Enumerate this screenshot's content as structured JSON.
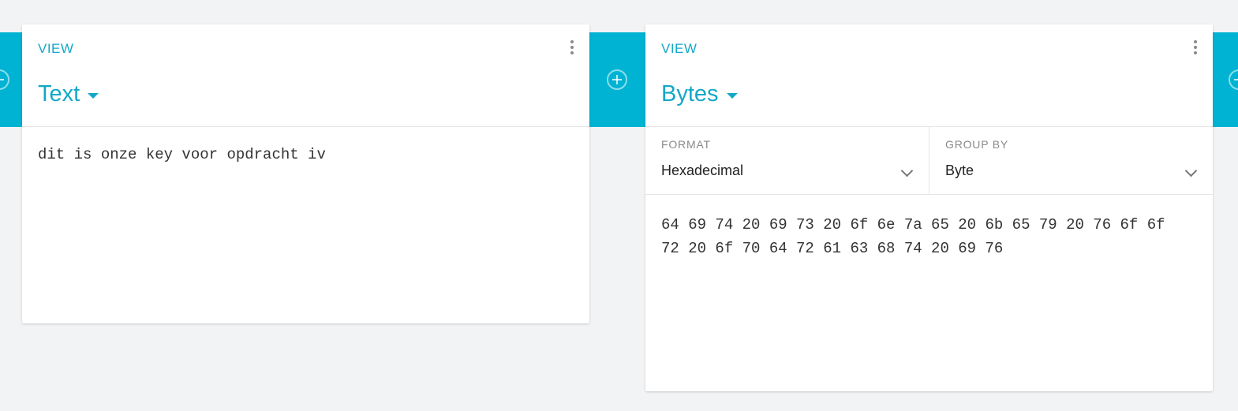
{
  "colors": {
    "accent": "#13a8c8",
    "band": "#00b3d3",
    "background": "#f2f3f5"
  },
  "left_panel": {
    "view_label": "VIEW",
    "view_type": "Text",
    "content": "dit is onze key voor opdracht iv"
  },
  "right_panel": {
    "view_label": "VIEW",
    "view_type": "Bytes",
    "format": {
      "label": "FORMAT",
      "value": "Hexadecimal"
    },
    "group_by": {
      "label": "GROUP BY",
      "value": "Byte"
    },
    "content_line1": "64 69 74 20 69 73 20 6f 6e 7a 65 20 6b 65 79 20 76 6f 6f",
    "content_line2": "72 20 6f 70 64 72 61 63 68 74 20 69 76"
  },
  "icons": {
    "add": "add-circle-icon",
    "menu": "more-vertical-icon",
    "dropdown": "caret-down-icon",
    "select": "chevron-down-icon"
  }
}
